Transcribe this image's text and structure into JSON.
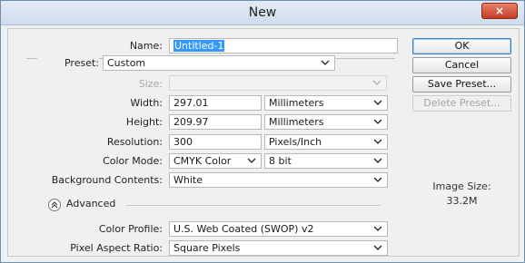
{
  "window": {
    "title": "New",
    "close_label": "×"
  },
  "form": {
    "name_label": "Name:",
    "name_value": "Untitled-1",
    "preset_label": "Preset:",
    "preset_value": "Custom",
    "size_label": "Size:",
    "size_value": "",
    "width_label": "Width:",
    "width_value": "297.01",
    "width_unit": "Millimeters",
    "height_label": "Height:",
    "height_value": "209.97",
    "height_unit": "Millimeters",
    "resolution_label": "Resolution:",
    "resolution_value": "300",
    "resolution_unit": "Pixels/Inch",
    "color_mode_label": "Color Mode:",
    "color_mode_value": "CMYK Color",
    "bit_depth_value": "8 bit",
    "background_label": "Background Contents:",
    "background_value": "White",
    "advanced_label": "Advanced",
    "color_profile_label": "Color Profile:",
    "color_profile_value": "U.S. Web Coated (SWOP) v2",
    "pixel_aspect_label": "Pixel Aspect Ratio:",
    "pixel_aspect_value": "Square Pixels"
  },
  "buttons": {
    "ok": "OK",
    "cancel": "Cancel",
    "save_preset": "Save Preset...",
    "delete_preset": "Delete Preset..."
  },
  "info": {
    "image_size_label": "Image Size:",
    "image_size_value": "33.2M"
  },
  "colors": {
    "title_bg": "#cfdced",
    "close_bg": "#c43c22",
    "selection": "#3399ff"
  }
}
